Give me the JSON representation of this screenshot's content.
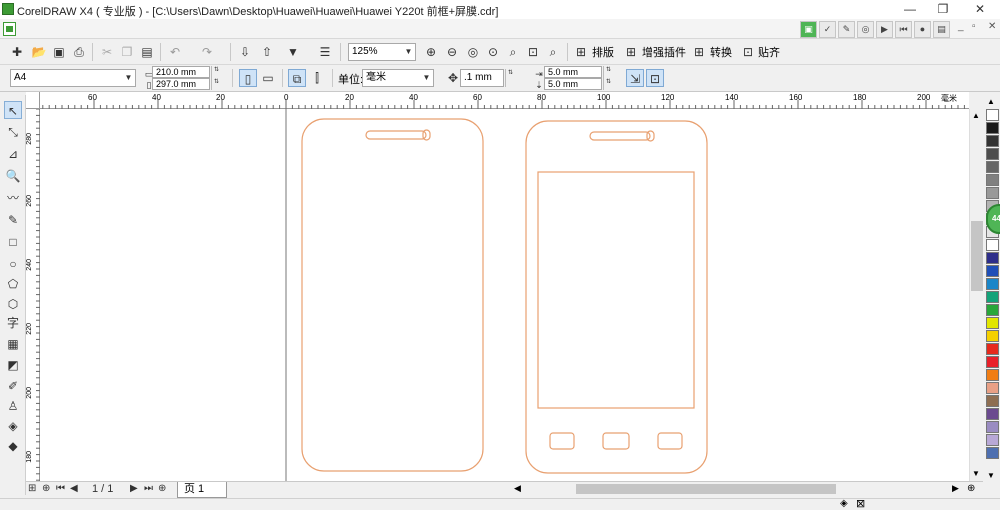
{
  "window": {
    "title": "CorelDRAW X4 ( 专业版 ) - [C:\\Users\\Dawn\\Desktop\\Huawei\\Huawei\\Huawei Y220t 前框+屏膜.cdr]",
    "minimize": "—",
    "restore": "❐",
    "close": "✕"
  },
  "toolbar1": {
    "zoom_value": "125%",
    "buttons": {
      "layout": "排版",
      "plugin": "增强插件",
      "convert": "转换",
      "align": "贴齐"
    }
  },
  "toolbar2": {
    "paper_size": "A4",
    "width": "210.0 mm",
    "height": "297.0 mm",
    "units_label": "单位:",
    "units_value": "毫米",
    "nudge": ".1 mm",
    "dup_x": "5.0 mm",
    "dup_y": "5.0 mm"
  },
  "hruler": {
    "ticks": [
      "60",
      "40",
      "20",
      "0",
      "20",
      "40",
      "60",
      "80",
      "100",
      "120",
      "140",
      "160",
      "180",
      "200"
    ],
    "unit": "毫米"
  },
  "vruler": {
    "ticks": [
      "280",
      "260",
      "240",
      "220",
      "200",
      "180"
    ]
  },
  "pagebar": {
    "page_counter": "1 / 1",
    "page_tab": "页 1"
  },
  "palette_colors": [
    "#ffffff",
    "#1a1a1a",
    "#333333",
    "#4d4d4d",
    "#666666",
    "#808080",
    "#999999",
    "#b3b3b3",
    "#cccccc",
    "#e6e6e6",
    "#ffffff",
    "#2e2e8a",
    "#1f4fb8",
    "#1b86c9",
    "#14a37a",
    "#29a63a",
    "#e2e600",
    "#f5d000",
    "#e62a1d",
    "#e8202a",
    "#f07d14",
    "#e8a086",
    "#8e6e52",
    "#6b4a8f",
    "#9a8cc2",
    "#b8a8d6",
    "#4e6fb0"
  ],
  "canvas": {
    "outline_color": "#e8a070"
  }
}
